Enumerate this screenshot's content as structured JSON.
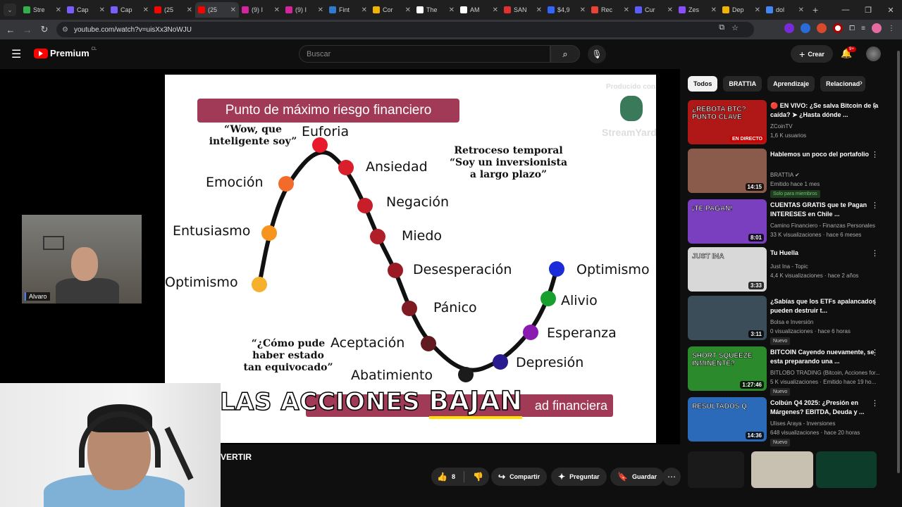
{
  "browser": {
    "tabs": [
      {
        "title": "Stre",
        "color": "#2fb24b"
      },
      {
        "title": "Cap",
        "color": "#7a5cff"
      },
      {
        "title": "Cap",
        "color": "#7a5cff"
      },
      {
        "title": "(25",
        "color": "#ff0000"
      },
      {
        "title": "(25",
        "color": "#ff0000"
      },
      {
        "title": "(9) I",
        "color": "#d6249f"
      },
      {
        "title": "(9) I",
        "color": "#d6249f"
      },
      {
        "title": "Fint",
        "color": "#2e7bcf"
      },
      {
        "title": "Cor",
        "color": "#f0b400"
      },
      {
        "title": "The",
        "color": "#ffffff"
      },
      {
        "title": "AM",
        "color": "#ffffff"
      },
      {
        "title": "SAN",
        "color": "#e03030"
      },
      {
        "title": "$4,9",
        "color": "#3066ff"
      },
      {
        "title": "Rec",
        "color": "#ea4335"
      },
      {
        "title": "Cur",
        "color": "#5b5bff"
      },
      {
        "title": "Zes",
        "color": "#8a4dff"
      },
      {
        "title": "Dep",
        "color": "#f0b400"
      },
      {
        "title": "dol",
        "color": "#4285f4"
      }
    ],
    "active_tab_index": 4,
    "url": "youtube.com/watch?v=uisXx3NoWJU"
  },
  "youtube": {
    "logo_text": "Premium",
    "country": "CL",
    "search_placeholder": "Buscar",
    "create_label": "Crear",
    "notifications_badge": "9+"
  },
  "slide": {
    "title": "Punto de máximo riesgo financiero",
    "bottom_banner": "ad financiera",
    "watermark_top": "Producido con",
    "watermark_brand": "StreamYard",
    "stages": [
      {
        "label": "Optimismo",
        "color": "#f7b02b"
      },
      {
        "label": "Entusiasmo",
        "color": "#f7941d"
      },
      {
        "label": "Emoción",
        "color": "#f26b2a"
      },
      {
        "label": "Euforia",
        "color": "#e8192c"
      },
      {
        "label": "Ansiedad",
        "color": "#d91f2b"
      },
      {
        "label": "Negación",
        "color": "#c81e2a"
      },
      {
        "label": "Miedo",
        "color": "#b01e28"
      },
      {
        "label": "Desesperación",
        "color": "#9a1b24"
      },
      {
        "label": "Pánico",
        "color": "#7f1a22"
      },
      {
        "label": "Aceptación",
        "color": "#611a20"
      },
      {
        "label": "Abatimiento",
        "color": "#1b1b1b"
      },
      {
        "label": "Depresión",
        "color": "#2a1a8f"
      },
      {
        "label": "Esperanza",
        "color": "#8b1bb0"
      },
      {
        "label": "Alivio",
        "color": "#18a02f"
      },
      {
        "label": "Optimismo",
        "color": "#1a2bd8"
      }
    ],
    "quotes": {
      "euphoria": "“Wow, que inteligente soy”",
      "retreat": "Retroceso temporal “Soy un inversionista a largo plazo”",
      "acceptance": "“¿Cómo pude haber estado tan equivocado”"
    }
  },
  "overlay_caption": {
    "prefix": "LAS ACCIONES",
    "highlight": "BAJAN"
  },
  "webcams": {
    "guest_name": "Alvaro"
  },
  "video": {
    "title_fragment": "VERTIR",
    "likes": "8",
    "share_label": "Compartir",
    "ask_label": "Preguntar",
    "save_label": "Guardar"
  },
  "chips": [
    "Todos",
    "BRATTIA",
    "Aprendizaje",
    "Relacionad"
  ],
  "recommendations": [
    {
      "title": "🔴 EN VIVO: ¿Se salva Bitcoin de la caída? ➤ ¿Hasta dónde ...",
      "channel": "ZCoinTV",
      "meta": "1,6 K usuarios",
      "badge": "",
      "duration": "EN DIRECTO",
      "live": true,
      "thumb_text": "¿REBOTA BTC? PUNTO CLAVE",
      "thumb_color": "#b01818"
    },
    {
      "title": "Hablemos un poco del portafolio",
      "channel": "BRATTIA ✔",
      "meta": "Emitido hace 1 mes",
      "badge": "Solo para miembros",
      "duration": "14:15",
      "live": false,
      "thumb_text": "",
      "thumb_color": "#8a5a4a"
    },
    {
      "title": "CUENTAS GRATIS que te Pagan INTERESES en Chile ...",
      "channel": "Camino Financiero - Finanzas Personales",
      "meta": "33 K visualizaciones · hace 6 meses",
      "badge": "",
      "duration": "8:01",
      "live": false,
      "thumb_text": "¡TE PAGAN!",
      "thumb_color": "#7a3fbf"
    },
    {
      "title": "Tu Huella",
      "channel": "Just Ina - Topic",
      "meta": "4,4 K visualizaciones · hace 2 años",
      "badge": "",
      "duration": "3:33",
      "live": false,
      "thumb_text": "JUST INA",
      "thumb_color": "#d8d8d8"
    },
    {
      "title": "¿Sabías que los ETFs apalancados pueden destruir t...",
      "channel": "Bolsa e Inversión",
      "meta": "0 visualizaciones · hace 6 horas",
      "badge": "Nuevo",
      "duration": "3:11",
      "live": false,
      "thumb_text": "",
      "thumb_color": "#3c4d5a"
    },
    {
      "title": "BITCOIN Cayendo nuevamente, se esta preparando una ...",
      "channel": "BITLOBO TRADING (Bitcoin, Acciones for...",
      "meta": "5 K visualizaciones · Emitido hace 19 ho...",
      "badge": "Nuevo",
      "duration": "1:27:46",
      "live": false,
      "thumb_text": "SHORT SQUEEZE INMINENTE?",
      "thumb_color": "#2b8a2b"
    },
    {
      "title": "Colbún Q4 2025: ¿Presión en Márgenes? EBITDA, Deuda y ...",
      "channel": "Ulises Araya - Inversiones",
      "meta": "648 visualizaciones · hace 20 horas",
      "badge": "Nuevo",
      "duration": "14:36",
      "live": false,
      "thumb_text": "RESULTADOS Q",
      "thumb_color": "#2a6ab8"
    }
  ]
}
